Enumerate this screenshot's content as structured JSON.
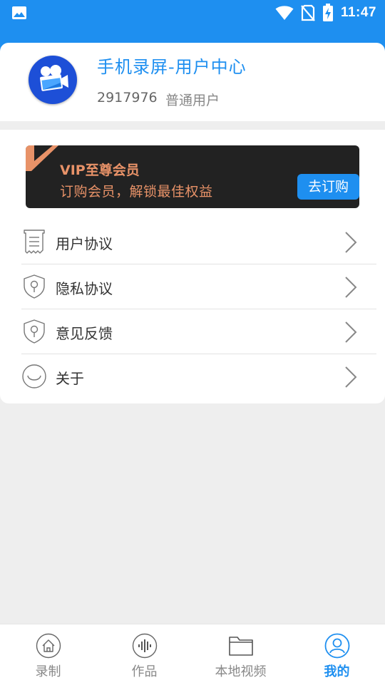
{
  "status_bar": {
    "time": "11:47",
    "icons": [
      "image-icon",
      "wifi-icon",
      "no-sim-icon",
      "battery-charging-icon"
    ]
  },
  "profile": {
    "app_title": "手机录屏-用户中心",
    "user_id": "2917976",
    "user_type": "普通用户",
    "avatar_icon": "video-camera-icon"
  },
  "vip_banner": {
    "title": "VIP至尊会员",
    "subtitle": "订购会员，解锁最佳权益",
    "button_label": "去订购",
    "text_color": "#e89268",
    "background": "#222222"
  },
  "menu": {
    "items": [
      {
        "label": "用户协议",
        "icon": "document-icon"
      },
      {
        "label": "隐私协议",
        "icon": "shield-icon"
      },
      {
        "label": "意见反馈",
        "icon": "shield-icon"
      },
      {
        "label": "关于",
        "icon": "smile-icon"
      }
    ]
  },
  "bottom_nav": {
    "tabs": [
      {
        "label": "录制",
        "icon": "home-icon",
        "active": false
      },
      {
        "label": "作品",
        "icon": "audio-wave-icon",
        "active": false
      },
      {
        "label": "本地视频",
        "icon": "folder-icon",
        "active": false
      },
      {
        "label": "我的",
        "icon": "user-icon",
        "active": true
      }
    ]
  },
  "colors": {
    "accent": "#1e8ff0",
    "background": "#eeeeee"
  }
}
